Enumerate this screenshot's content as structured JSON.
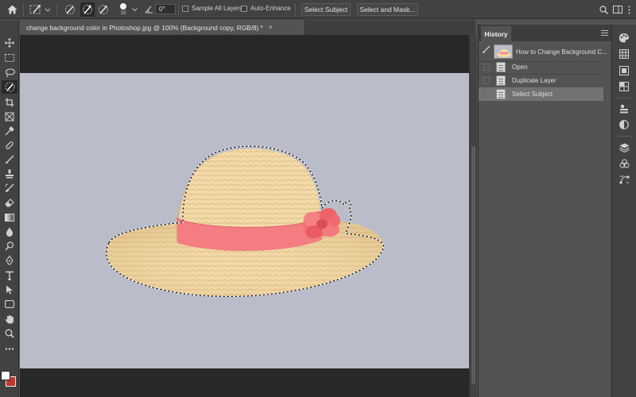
{
  "options_bar": {
    "brush_size": "15",
    "angle": "0°",
    "sample_all_layers_label": "Sample All Layers",
    "auto_enhance_label": "Auto-Enhance",
    "select_subject_label": "Select Subject",
    "select_and_mask_label": "Select and Mask..."
  },
  "document": {
    "tab_title": "change background color in Photoshop.jpg @ 100% (Background copy, RGB/8) *",
    "close_glyph": "×",
    "canvas_background": "#bbbcc9",
    "subject": "straw hat with pink ribbon and flower"
  },
  "history": {
    "tab_label": "History",
    "snapshot_label": "How to Change Background C...",
    "states": [
      {
        "label": "Open",
        "selected": false
      },
      {
        "label": "Duplicate Layer",
        "selected": false
      },
      {
        "label": "Select Subject",
        "selected": true
      }
    ]
  },
  "left_tools": [
    "move-tool-icon",
    "marquee-tool-icon",
    "lasso-tool-icon",
    "quick-selection-tool-icon",
    "crop-tool-icon",
    "frame-tool-icon",
    "eyedropper-tool-icon",
    "healing-brush-icon",
    "brush-tool-icon",
    "clone-stamp-icon",
    "history-brush-icon",
    "eraser-icon",
    "gradient-tool-icon",
    "blur-tool-icon",
    "dodge-tool-icon",
    "pen-tool-icon",
    "type-tool-icon",
    "path-selection-icon",
    "rectangle-tool-icon",
    "hand-tool-icon",
    "zoom-tool-icon",
    "more-tools-icon"
  ],
  "colors": {
    "foreground": "#ffffff",
    "background": "#c0392b",
    "ui_dark": "#424242",
    "ui_panel": "#535353"
  }
}
